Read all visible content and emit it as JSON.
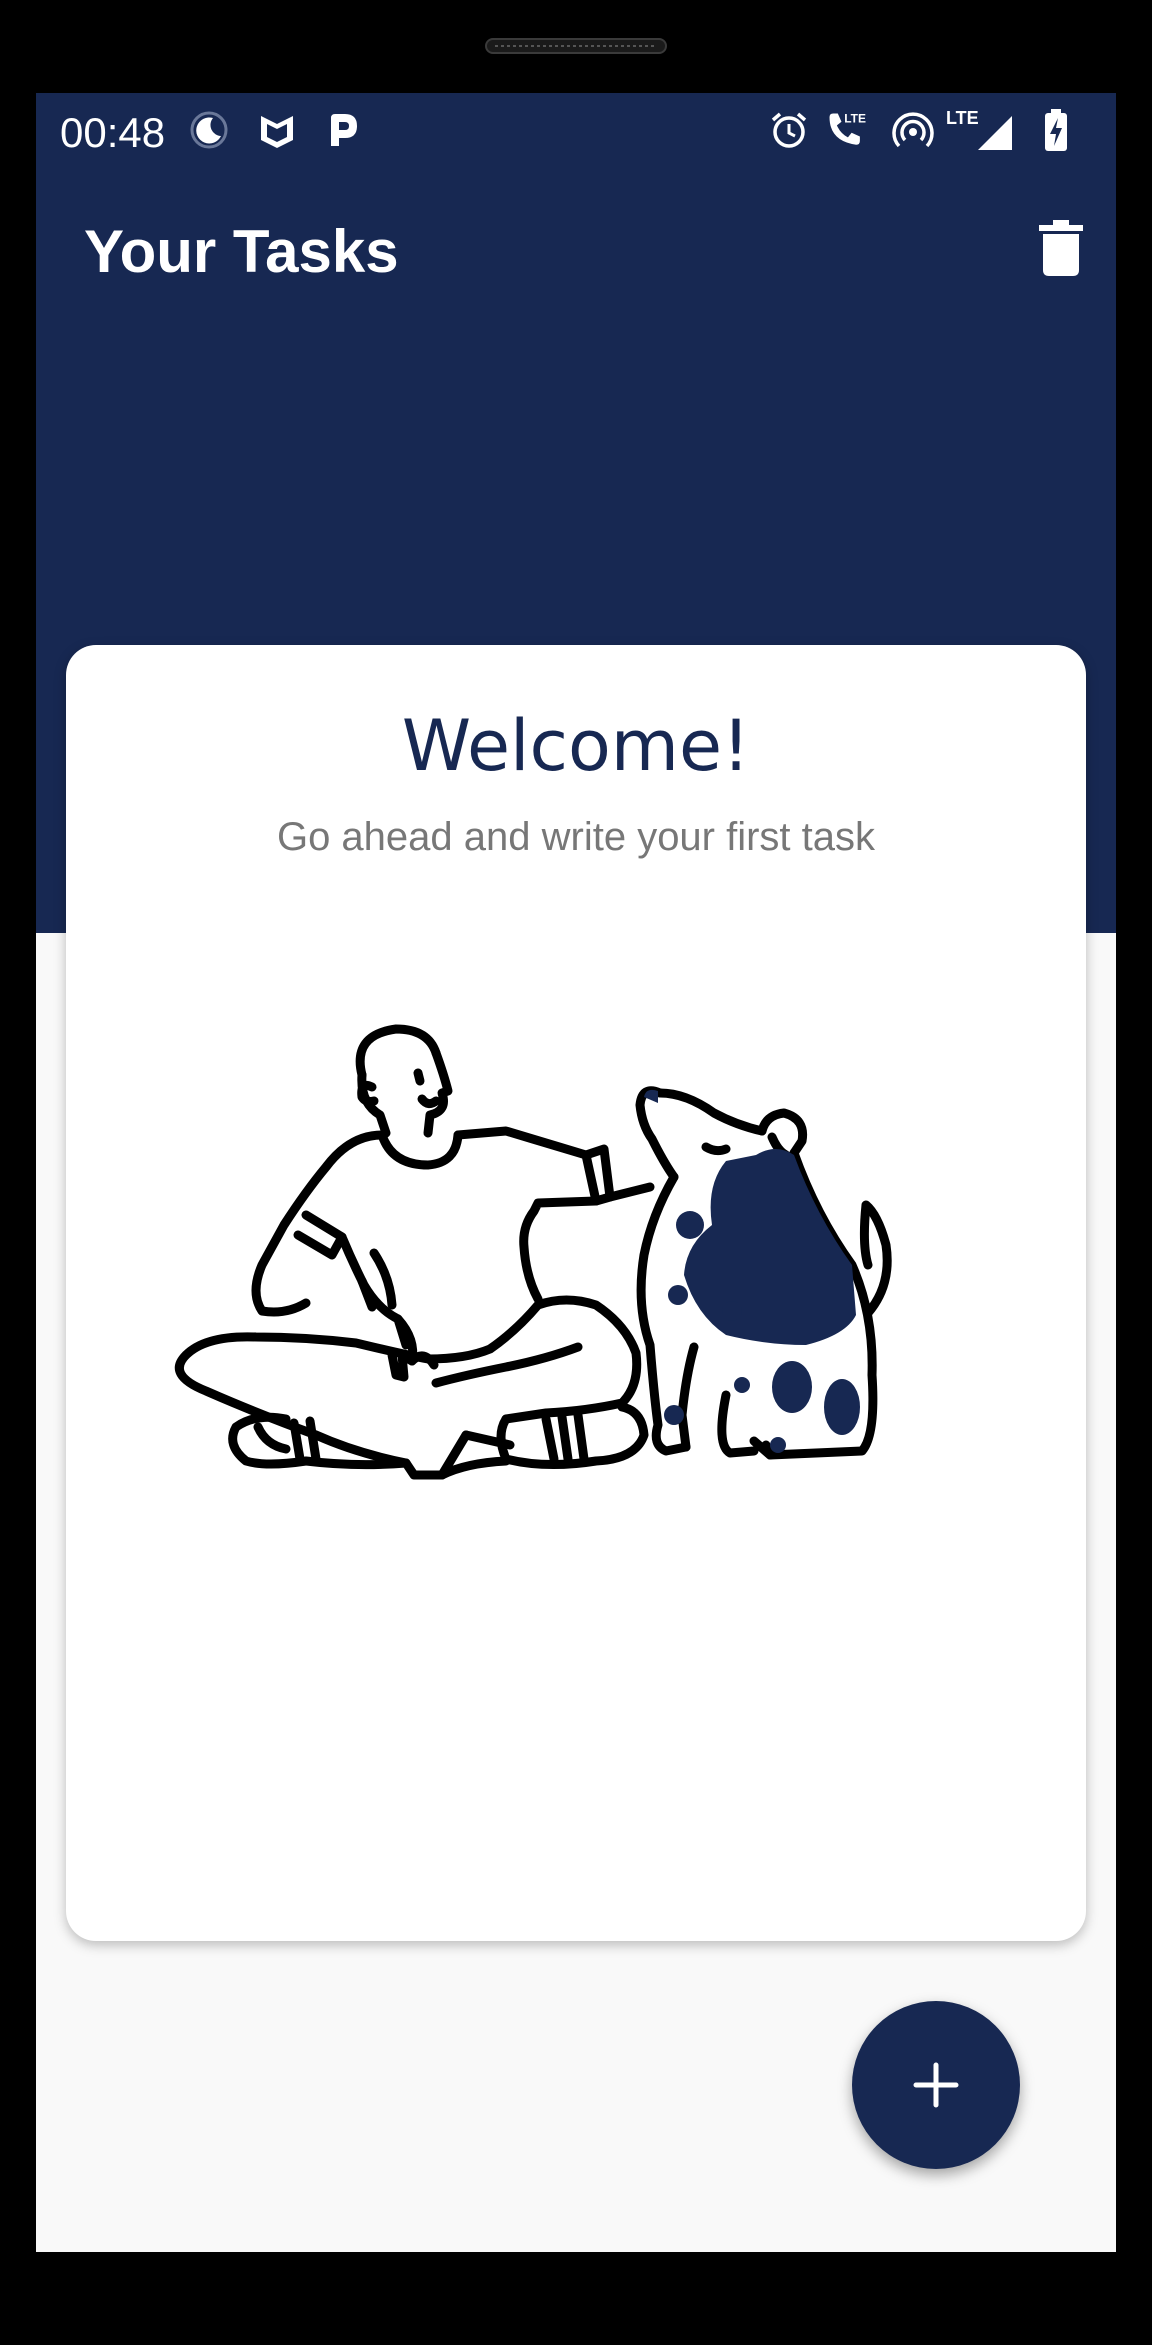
{
  "status_bar": {
    "time": "00:48",
    "left_icons": [
      "night-mode-icon",
      "mcafee-icon",
      "parking-icon"
    ],
    "right_icons": [
      "alarm-icon",
      "volte-call-icon",
      "hotspot-icon",
      "lte-signal-icon",
      "battery-charging-icon"
    ],
    "lte_label": "LTE"
  },
  "app_bar": {
    "title": "Your Tasks",
    "action_icon": "trash-icon"
  },
  "welcome_card": {
    "title": "Welcome!",
    "subtitle": "Go ahead and write your first task",
    "illustration": "man-with-dog-illustration"
  },
  "fab": {
    "icon": "plus-icon"
  },
  "colors": {
    "primary": "#172852",
    "background": "#f9f9f9",
    "card": "#ffffff",
    "subtitle": "#777777"
  }
}
